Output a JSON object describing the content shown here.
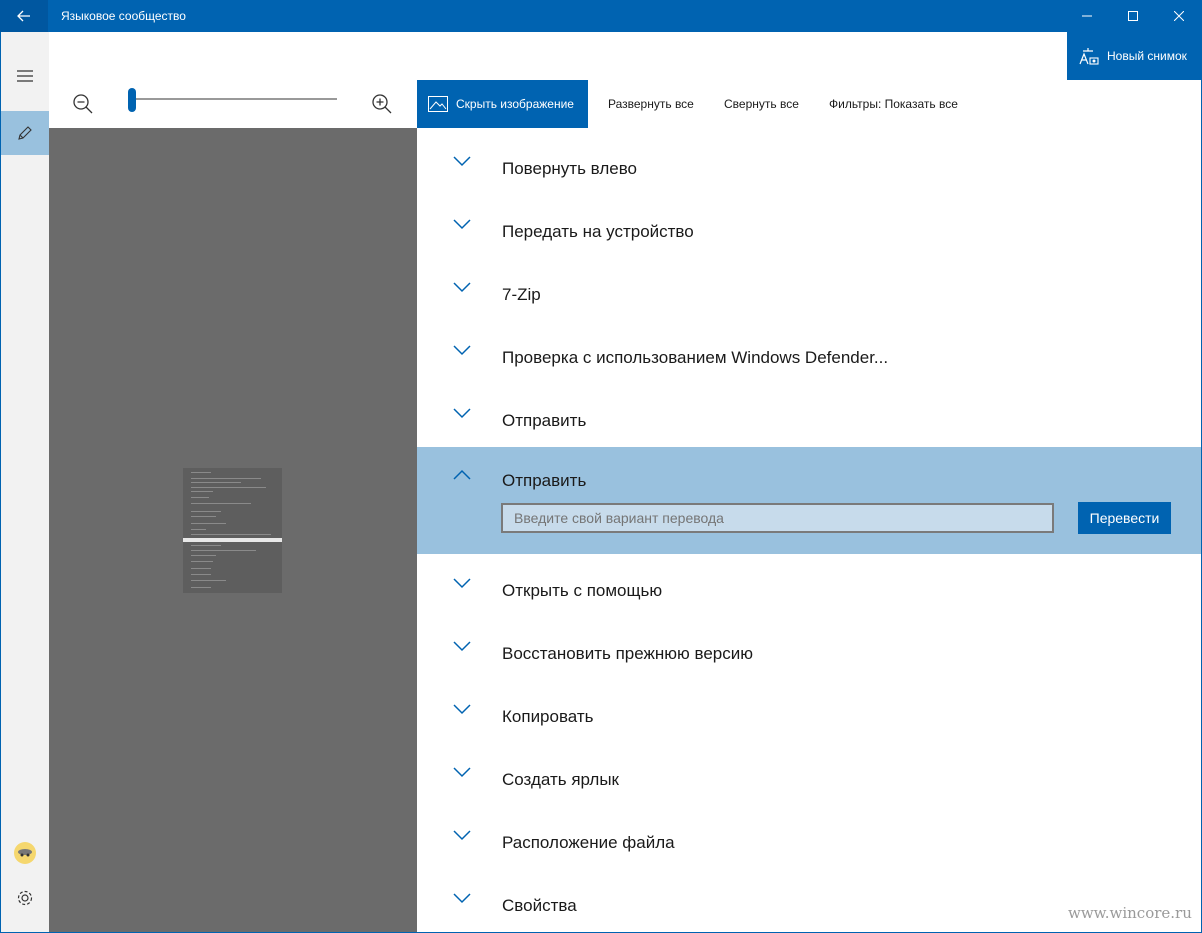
{
  "window": {
    "title": "Языковое сообщество"
  },
  "toolbar": {
    "hide_image": "Скрыть изображение",
    "expand_all": "Развернуть все",
    "collapse_all": "Свернуть все",
    "filters": "Фильтры: Показать все",
    "new_snapshot": "Новый снимок"
  },
  "zoom": {
    "level": 0
  },
  "list": {
    "items": [
      {
        "label": "Повернуть влево",
        "expanded": false
      },
      {
        "label": "Передать на устройство",
        "expanded": false
      },
      {
        "label": "7-Zip",
        "expanded": false
      },
      {
        "label": "Проверка с использованием Windows Defender...",
        "expanded": false
      },
      {
        "label": "Отправить",
        "expanded": false
      },
      {
        "label": "Отправить",
        "expanded": true
      },
      {
        "label": "Открыть с помощью",
        "expanded": false
      },
      {
        "label": "Восстановить прежнюю версию",
        "expanded": false
      },
      {
        "label": "Копировать",
        "expanded": false
      },
      {
        "label": "Создать ярлык",
        "expanded": false
      },
      {
        "label": "Расположение файла",
        "expanded": false
      },
      {
        "label": "Свойства",
        "expanded": false
      }
    ]
  },
  "translation": {
    "placeholder": "Введите свой вариант перевода",
    "value": "",
    "submit_label": "Перевести"
  },
  "watermark": "www.wincore.ru",
  "colors": {
    "accent": "#0063b1",
    "selected_row": "#99c1de",
    "preview_bg": "#6b6b6b"
  }
}
